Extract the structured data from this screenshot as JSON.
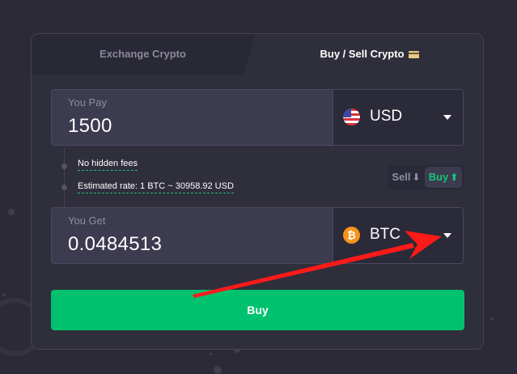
{
  "tabs": {
    "exchange_label": "Exchange Crypto",
    "buysell_label": "Buy / Sell Crypto"
  },
  "pay": {
    "label": "You Pay",
    "amount": "1500",
    "currency": "USD",
    "currency_icon": "us-flag-icon"
  },
  "info": {
    "fees": "No hidden fees",
    "rate": "Estimated rate: 1 BTC ~ 30958.92 USD"
  },
  "toggle": {
    "sell_label": "Sell",
    "buy_label": "Buy",
    "active": "buy"
  },
  "get": {
    "label": "You Get",
    "amount": "0.0484513",
    "currency": "BTC",
    "currency_icon": "bitcoin-icon",
    "currency_symbol": "₿"
  },
  "action": {
    "buy_label": "Buy"
  },
  "colors": {
    "background": "#2b2a36",
    "panel": "#2f2e3b",
    "field": "#3c3b4f",
    "accent_green": "#00c26e",
    "annotation_arrow": "#ff1a1a"
  }
}
